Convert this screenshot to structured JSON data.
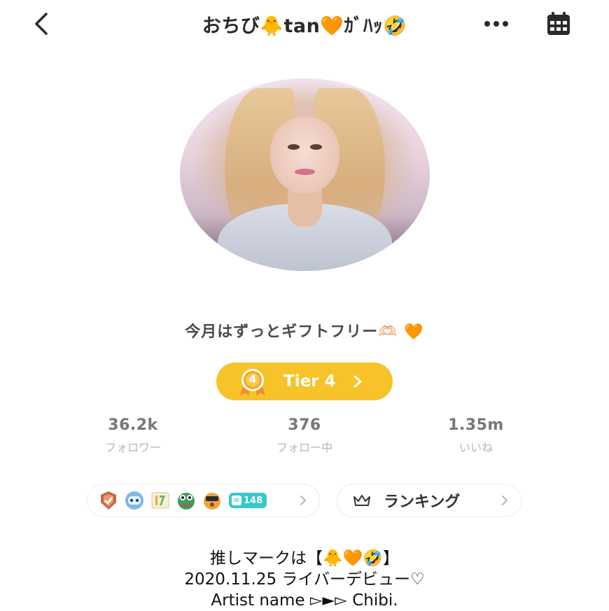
{
  "header": {
    "title": "おちび🐥tan🧡ｶﾞﾊｯ🤣",
    "back_icon": "chevron-left-icon",
    "more_icon": "more-horizontal-icon",
    "calendar_icon": "calendar-icon"
  },
  "profile": {
    "bio": "今月はずっとギフトフリー🫶🏻 🧡",
    "tier": {
      "label": "Tier 4",
      "medal_number": "4",
      "color": "#f7c328"
    }
  },
  "stats": [
    {
      "value": "36.2k",
      "label": "フォロワー"
    },
    {
      "value": "376",
      "label": "フォロー中"
    },
    {
      "value": "1.35m",
      "label": "いいね"
    }
  ],
  "badges": {
    "items": [
      "shield-badge-icon",
      "robot-badge-icon",
      "17-badge-icon",
      "frog-badge-icon",
      "dog-badge-icon"
    ],
    "count": "148"
  },
  "ranking": {
    "label": "ランキング",
    "icon": "crown-icon"
  },
  "description": {
    "line1": "推しマークは【🐥🧡🤣】",
    "line2": "2020.11.25  ライバーデビュー♡",
    "line3": "Artist name ▻►▻ Chibi."
  }
}
